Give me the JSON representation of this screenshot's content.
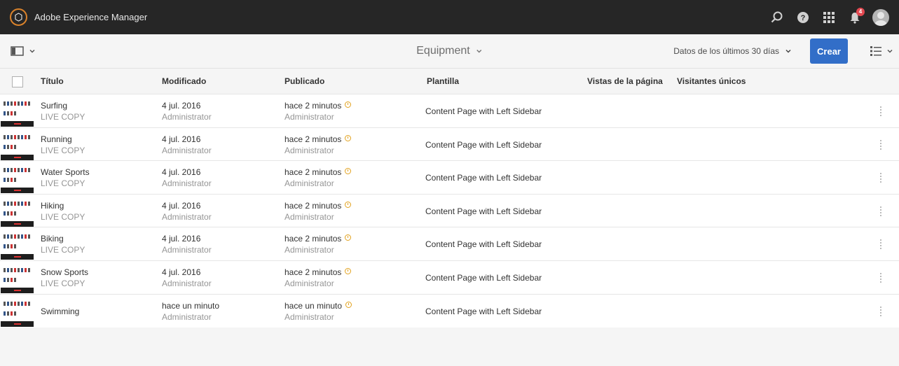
{
  "shell": {
    "app_title": "Adobe Experience Manager",
    "notification_count": "4",
    "icons": [
      "adobe-logo-icon",
      "search-icon",
      "help-icon",
      "apps-grid-icon",
      "bell-icon",
      "user-avatar"
    ]
  },
  "actionbar": {
    "breadcrumb_title": "Equipment",
    "date_range": "Datos de los últimos 30 días",
    "create_label": "Crear",
    "accent_color": "#326ec8"
  },
  "table": {
    "headers": {
      "title": "Título",
      "modified": "Modificado",
      "published": "Publicado",
      "template": "Plantilla",
      "page_views": "Vistas de la página",
      "unique_visitors": "Visitantes únicos"
    },
    "rows": [
      {
        "title": "Surfing",
        "subtitle": "LIVE COPY",
        "modified": "4 jul. 2016",
        "modified_by": "Administrator",
        "published": "hace 2 minutos",
        "published_by": "Administrator",
        "template": "Content Page with Left Sidebar"
      },
      {
        "title": "Running",
        "subtitle": "LIVE COPY",
        "modified": "4 jul. 2016",
        "modified_by": "Administrator",
        "published": "hace 2 minutos",
        "published_by": "Administrator",
        "template": "Content Page with Left Sidebar"
      },
      {
        "title": "Water Sports",
        "subtitle": "LIVE COPY",
        "modified": "4 jul. 2016",
        "modified_by": "Administrator",
        "published": "hace 2 minutos",
        "published_by": "Administrator",
        "template": "Content Page with Left Sidebar"
      },
      {
        "title": "Hiking",
        "subtitle": "LIVE COPY",
        "modified": "4 jul. 2016",
        "modified_by": "Administrator",
        "published": "hace 2 minutos",
        "published_by": "Administrator",
        "template": "Content Page with Left Sidebar"
      },
      {
        "title": "Biking",
        "subtitle": "LIVE COPY",
        "modified": "4 jul. 2016",
        "modified_by": "Administrator",
        "published": "hace 2 minutos",
        "published_by": "Administrator",
        "template": "Content Page with Left Sidebar"
      },
      {
        "title": "Snow Sports",
        "subtitle": "LIVE COPY",
        "modified": "4 jul. 2016",
        "modified_by": "Administrator",
        "published": "hace 2 minutos",
        "published_by": "Administrator",
        "template": "Content Page with Left Sidebar"
      },
      {
        "title": "Swimming",
        "subtitle": "",
        "modified": "hace un minuto",
        "modified_by": "Administrator",
        "published": "hace un minuto",
        "published_by": "Administrator",
        "template": "Content Page with Left Sidebar"
      }
    ]
  }
}
